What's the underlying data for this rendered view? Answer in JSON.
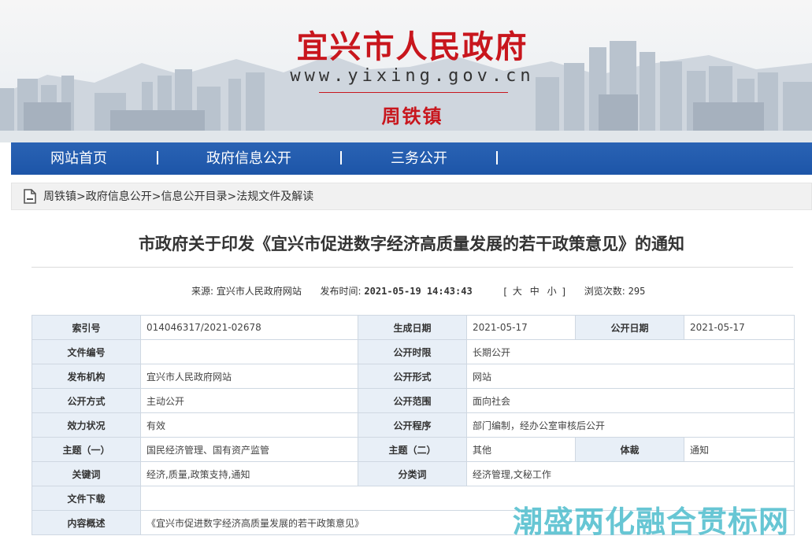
{
  "header": {
    "site_title": "宜兴市人民政府",
    "site_url": "www.yixing.gov.cn",
    "town": "周铁镇"
  },
  "nav": {
    "items": [
      {
        "label": "网站首页"
      },
      {
        "label": "政府信息公开"
      },
      {
        "label": "三务公开"
      }
    ]
  },
  "breadcrumb": {
    "items": [
      "周铁镇",
      "政府信息公开",
      "信息公开目录",
      "法规文件及解读"
    ],
    "separator": ">"
  },
  "article": {
    "title": "市政府关于印发《宜兴市促进数字经济高质量发展的若干政策意见》的通知",
    "source_label": "来源:",
    "source_value": "宜兴市人民政府网站",
    "publish_label": "发布时间:",
    "publish_value": "2021-05-19 14:43:43",
    "fontsize_open": "[",
    "fontsize_large": "大",
    "fontsize_medium": "中",
    "fontsize_small": "小",
    "fontsize_close": "]",
    "views_label": "浏览次数:",
    "views_value": "295"
  },
  "info_table": {
    "index_no_label": "索引号",
    "index_no": "014046317/2021-02678",
    "gen_date_label": "生成日期",
    "gen_date": "2021-05-17",
    "pub_date_label": "公开日期",
    "pub_date": "2021-05-17",
    "doc_no_label": "文件编号",
    "doc_no": "",
    "pub_period_label": "公开时限",
    "pub_period": "长期公开",
    "issuer_label": "发布机构",
    "issuer": "宜兴市人民政府网站",
    "pub_form_label": "公开形式",
    "pub_form": "网站",
    "pub_method_label": "公开方式",
    "pub_method": "主动公开",
    "pub_scope_label": "公开范围",
    "pub_scope": "面向社会",
    "validity_label": "效力状况",
    "validity": "有效",
    "procedure_label": "公开程序",
    "procedure": "部门编制，经办公室审核后公开",
    "topic1_label": "主题（一）",
    "topic1": "国民经济管理、国有资产监管",
    "topic2_label": "主题（二）",
    "topic2": "其他",
    "genre_label": "体裁",
    "genre": "通知",
    "keywords_label": "关键词",
    "keywords": "经济,质量,政策支持,通知",
    "category_label": "分类词",
    "category": "经济管理,文秘工作",
    "download_label": "文件下载",
    "download": "",
    "summary_label": "内容概述",
    "summary": "《宜兴市促进数字经济高质量发展的若干政策意见》"
  },
  "watermark": "潮盛两化融合贯标网",
  "colors": {
    "brand_red": "#c8161d",
    "nav_blue": "#1d55a8",
    "label_bg": "#e8eff7",
    "watermark": "#5bc2d1"
  },
  "icons": {
    "breadcrumb": "document-icon"
  }
}
